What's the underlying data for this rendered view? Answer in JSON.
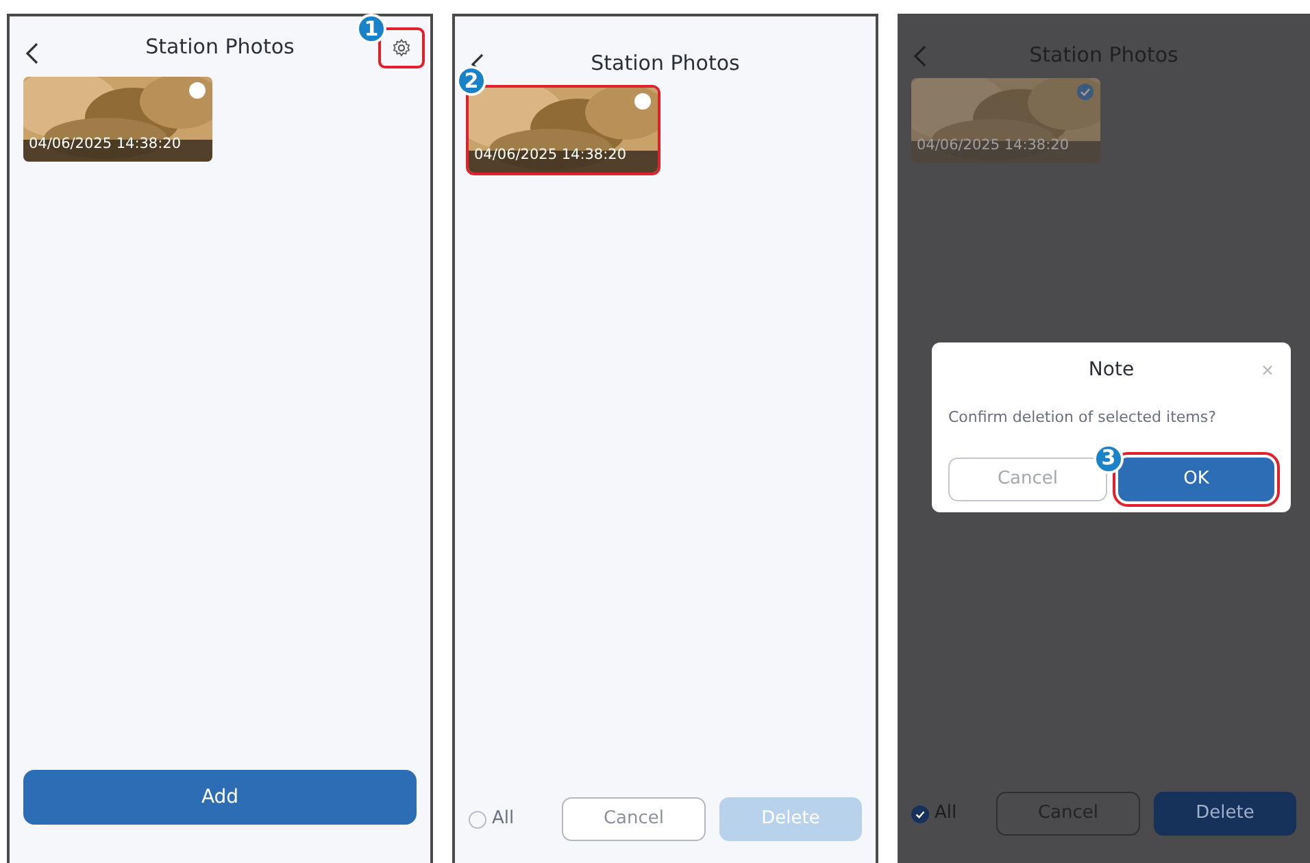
{
  "screens": [
    {
      "kind": "browse",
      "title": "Station Photos",
      "settings": {
        "callout": "1"
      },
      "photos": [
        {
          "timestamp": "04/06/2025 14:38:20",
          "selected": false
        }
      ],
      "add_button": "Add"
    },
    {
      "kind": "select",
      "title": "Station Photos",
      "photos": [
        {
          "timestamp": "04/06/2025 14:38:20",
          "selected": false,
          "callout": "2"
        }
      ],
      "footer": {
        "all": {
          "label": "All",
          "checked": false
        },
        "cancel": "Cancel",
        "delete": {
          "label": "Delete",
          "disabled": true
        }
      }
    },
    {
      "kind": "confirm",
      "title": "Station Photos",
      "photos": [
        {
          "timestamp": "04/06/2025 14:38:20",
          "selected": true
        }
      ],
      "footer": {
        "all": {
          "label": "All",
          "checked": true
        },
        "cancel": "Cancel",
        "delete": {
          "label": "Delete",
          "disabled": false
        }
      },
      "dialog": {
        "title": "Note",
        "close": "×",
        "message": "Confirm deletion of selected items?",
        "buttons": [
          {
            "kind": "secondary",
            "label": "Cancel"
          },
          {
            "kind": "primary",
            "label": "OK",
            "callout": "3"
          }
        ]
      }
    }
  ]
}
